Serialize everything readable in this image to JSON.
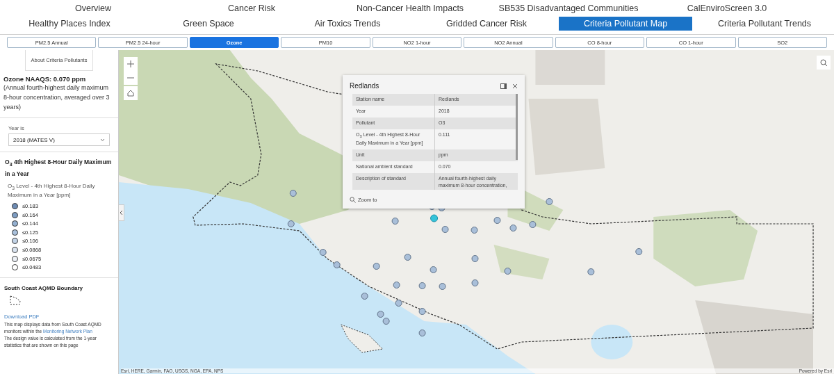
{
  "nav": [
    [
      {
        "label": "Overview",
        "selected": false
      },
      {
        "label": "Cancer Risk",
        "selected": false
      },
      {
        "label": "Non-Cancer Health Impacts",
        "selected": false
      },
      {
        "label": "SB535 Disadvantaged Communities",
        "selected": false
      },
      {
        "label": "CalEnviroScreen 3.0",
        "selected": false
      }
    ],
    [
      {
        "label": "Healthy Places Index",
        "selected": false
      },
      {
        "label": "Green Space",
        "selected": false
      },
      {
        "label": "Air Toxics Trends",
        "selected": false
      },
      {
        "label": "Gridded Cancer Risk",
        "selected": false
      },
      {
        "label": "Criteria Pollutant Map",
        "selected": true
      },
      {
        "label": "Criteria Pollutant Trends",
        "selected": false
      }
    ]
  ],
  "pollutant_tabs": [
    {
      "label": "PM2.5 Annual",
      "selected": false
    },
    {
      "label": "PM2.5 24-hour",
      "selected": false
    },
    {
      "label": "Ozone",
      "selected": true
    },
    {
      "label": "PM10",
      "selected": false
    },
    {
      "label": "NO2 1-hour",
      "selected": false
    },
    {
      "label": "NO2 Annual",
      "selected": false
    },
    {
      "label": "CO 8-hour",
      "selected": false
    },
    {
      "label": "CO 1-hour",
      "selected": false
    },
    {
      "label": "SO2",
      "selected": false
    }
  ],
  "sidebar": {
    "about_button": "About Criteria Pollutants",
    "standard_title": "Ozone NAAQS: 0.070 ppm",
    "standard_note": "(Annual fourth-highest daily maximum 8-hour concentration, averaged over 3 years)",
    "year_label": "Year is",
    "year_value": "2018 (MATES V)",
    "legend_title": "O$_{3}$ 4th Highest 8-Hour Daily Maximum in a Year",
    "legend_subtitle": "O$_{3}$ Level - 4th Highest 8-Hour Daily Maximum in a Year [ppm]",
    "legend": [
      {
        "label": "≤0.183",
        "color": "#6e8cb4"
      },
      {
        "label": "≤0.164",
        "color": "#7d9cc2"
      },
      {
        "label": "≤0.144",
        "color": "#94b0d0"
      },
      {
        "label": "≤0.125",
        "color": "#a9c0db"
      },
      {
        "label": "≤0.106",
        "color": "#c3d4e8"
      },
      {
        "label": "≤0.0868",
        "color": "#dbe5f1"
      },
      {
        "label": "≤0.0675",
        "color": "#eef2f8"
      },
      {
        "label": "≤0.0483",
        "color": "#ffffff"
      }
    ],
    "boundary_title": "South Coast AQMD Boundary",
    "download_link": "Download PDF",
    "note_1": "This map displays data from South Coast AQMD monitors within the",
    "note_link": "Monitoring Network Plan",
    "note_2": "The design value is calculated from the 1-year statistics that are shown on this page"
  },
  "popup": {
    "title": "Redlands",
    "rows": [
      {
        "field": "Station name",
        "value": "Redlands"
      },
      {
        "field": "Year",
        "value": "2018"
      },
      {
        "field": "Pollutant",
        "value": "O3"
      },
      {
        "field": "O$_{3}$ Level - 4th Highest 8-Hour Daily Maximum in a Year [ppm]",
        "value": "0.111"
      },
      {
        "field": "Unit",
        "value": "ppm"
      },
      {
        "field": "National ambient standard",
        "value": "0.070"
      },
      {
        "field": "Description of standard",
        "value": "Annual fourth-highest daily maximum 8-hour concentration,"
      }
    ],
    "zoom_link": "Zoom to"
  },
  "map": {
    "attribution": "Esri, HERE, Garmin, FAO, USGS, NGA, EPA, NPS",
    "powered_by": "Powered by Esri"
  }
}
